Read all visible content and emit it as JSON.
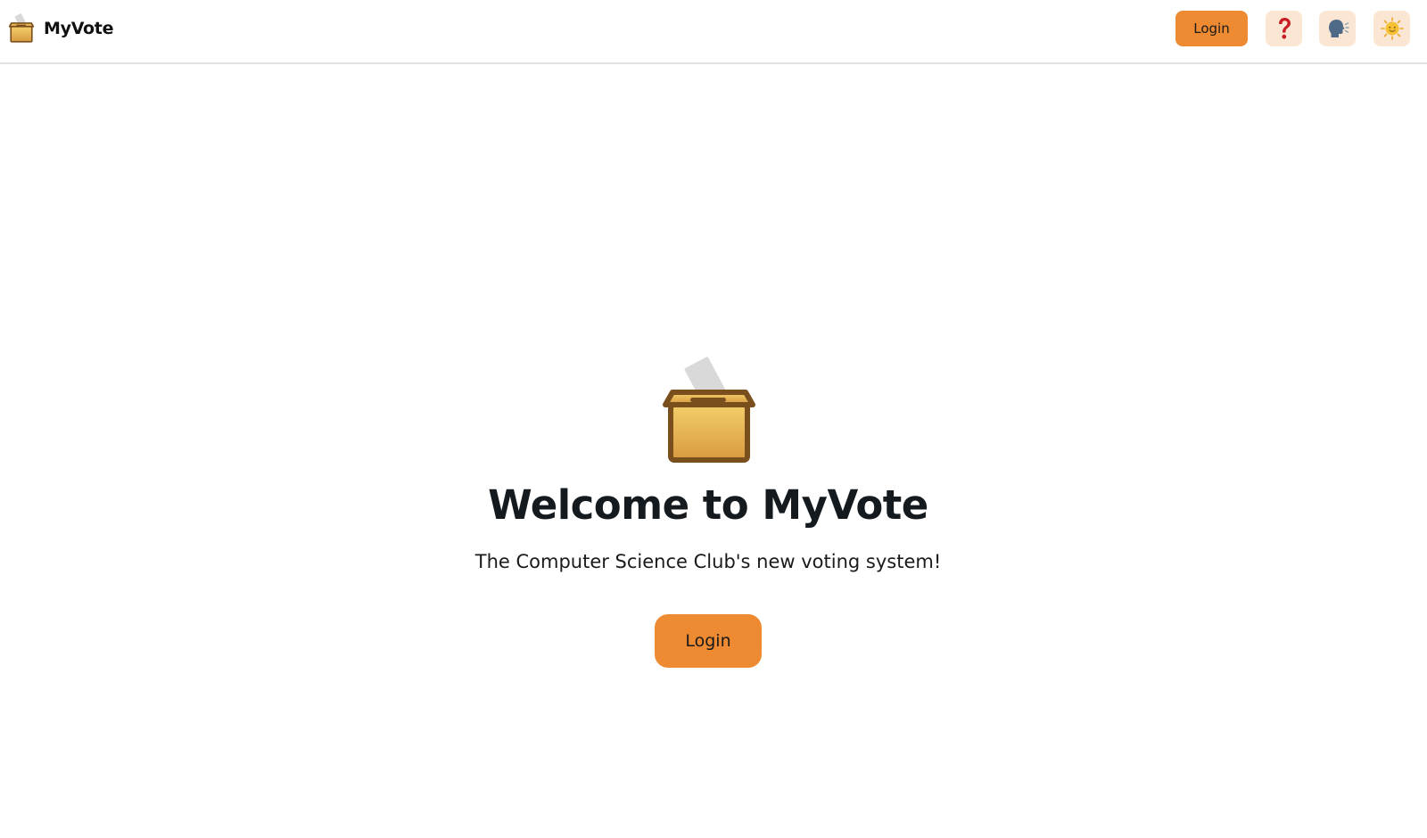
{
  "header": {
    "app_name": "MyVote",
    "login_label": "Login",
    "logo_icon": "ballot-box-icon",
    "help_icon": "question-mark-icon",
    "language_icon": "speaking-head-icon",
    "theme_icon": "sun-icon"
  },
  "hero": {
    "icon": "ballot-box-icon",
    "title": "Welcome to MyVote",
    "subtitle": "The Computer Science Club's new voting system!",
    "login_label": "Login"
  },
  "colors": {
    "accent": "#ee8a31",
    "icon_button_bg": "#fbe6d3",
    "border": "#e2e2e2"
  }
}
